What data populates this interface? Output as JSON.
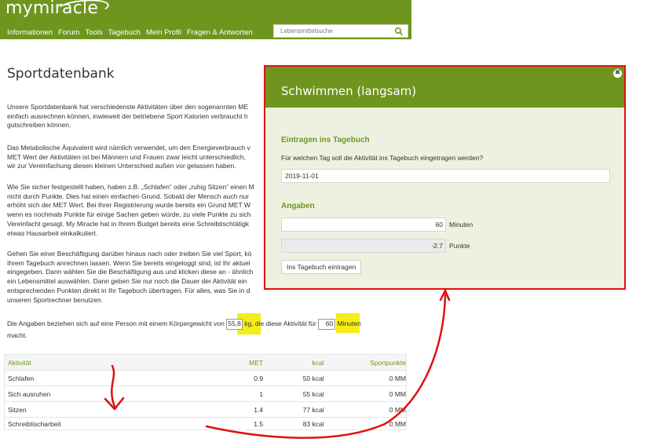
{
  "header": {
    "logo_text": "mymiracle",
    "nav": [
      "Informationen",
      "Forum",
      "Tools",
      "Tagebuch",
      "Mein Profil",
      "Fragen & Antworten"
    ],
    "search_placeholder": "Lebensmittelsuche",
    "brand_color": "#6e961f"
  },
  "page": {
    "title": "Sportdatenbank",
    "p1": [
      "Unsere Sportdatenbank hat verschiedenste Aktivitäten über den sogenannten ME",
      "einfach ausrechnen können, inwieweit der betriebene Sport Kalorien verbraucht h",
      "gutschreiben können."
    ],
    "p2": [
      "Das Metabolische Äquivalent wird nämlich verwendet, um den Energieverbrauch v",
      "MET Wert der Aktivitäten ist bei Männern und Frauen zwar leicht unterschiedlich,",
      "wir zur Vereinfachung diesen kleinen Unterschied außen vor gelassen haben."
    ],
    "p3": [
      "Wie Sie sicher festgestellt haben, haben z.B. „Schlafen“ oder „ruhig Sitzen“ einen M",
      "nicht durch Punkte. Dies hat einen einfachen Grund. Sobald der Mensch auch nur",
      "erhöht sich der MET Wert. Bei Ihrer Registrierung wurde bereits ein Grund MET W",
      "wenn es nochmals Punkte für einige Sachen geben würde, zu viele Punkte zu sich",
      "Vereinfacht gesagt. My Miracle hat in Ihrem Budget bereits eine Schreibtischtätigk",
      "etwas Hausarbeit einkalkuliert."
    ],
    "p4": [
      "Gehen Sie einer Beschäftigung darüber hinaus nach oder treiben Sie viel Sport, kö",
      "Ihrem Tagebuch anrechnen lassen. Wenn Sie bereits eingeloggt sind, ist Ihr aktuel",
      "eingegeben. Dann wählen Sie die Beschäftigung aus und klicken diese an - ähnlich",
      "ein Lebensmittel auswählen. Dann geben Sie nur noch die Dauer der Aktivität ein",
      "entsprechenden Punkten direkt in Ihr Tagebuch übertragen. Für alles, was Sie in d",
      "unseren Sportrechner benutzen."
    ],
    "p5_before": "Die Angaben beziehen sich auf eine Person mit einem Körpergewicht von",
    "weight_value": "55,8",
    "p5_mid": "kg, die diese Aktivität für",
    "minutes_value": "60",
    "p5_after": "Minuten",
    "p5_line2": "macht."
  },
  "table": {
    "headers": [
      "Aktivität",
      "MET",
      "kcal",
      "Sportpunkte"
    ],
    "rows": [
      [
        "Schlafen",
        "0.9",
        "50 kcal",
        "0 MM"
      ],
      [
        "Sich ausruhen",
        "1",
        "55 kcal",
        "0 MM"
      ],
      [
        "Sitzen",
        "1.4",
        "77 kcal",
        "0 MM"
      ],
      [
        "Schreibtischarbeit",
        "1.5",
        "83 kcal",
        "0 MM"
      ]
    ]
  },
  "modal": {
    "title": "Schwimmen (langsam)",
    "section1": "Eintragen ins Tagebuch",
    "question": "Für welchen Tag soll die Aktivität ins Tagebuch eingetragen werden?",
    "date_value": "2019-11-01",
    "section2": "Angaben",
    "minutes_value": "60",
    "minutes_unit": "Minuten",
    "points_value": "-2.7",
    "points_unit": "Punkte",
    "submit_label": "Ins Tagebuch eintragen",
    "close_glyph": "✖"
  },
  "colors": {
    "highlight": "#f5ec19",
    "annotation_red": "#e01010"
  }
}
